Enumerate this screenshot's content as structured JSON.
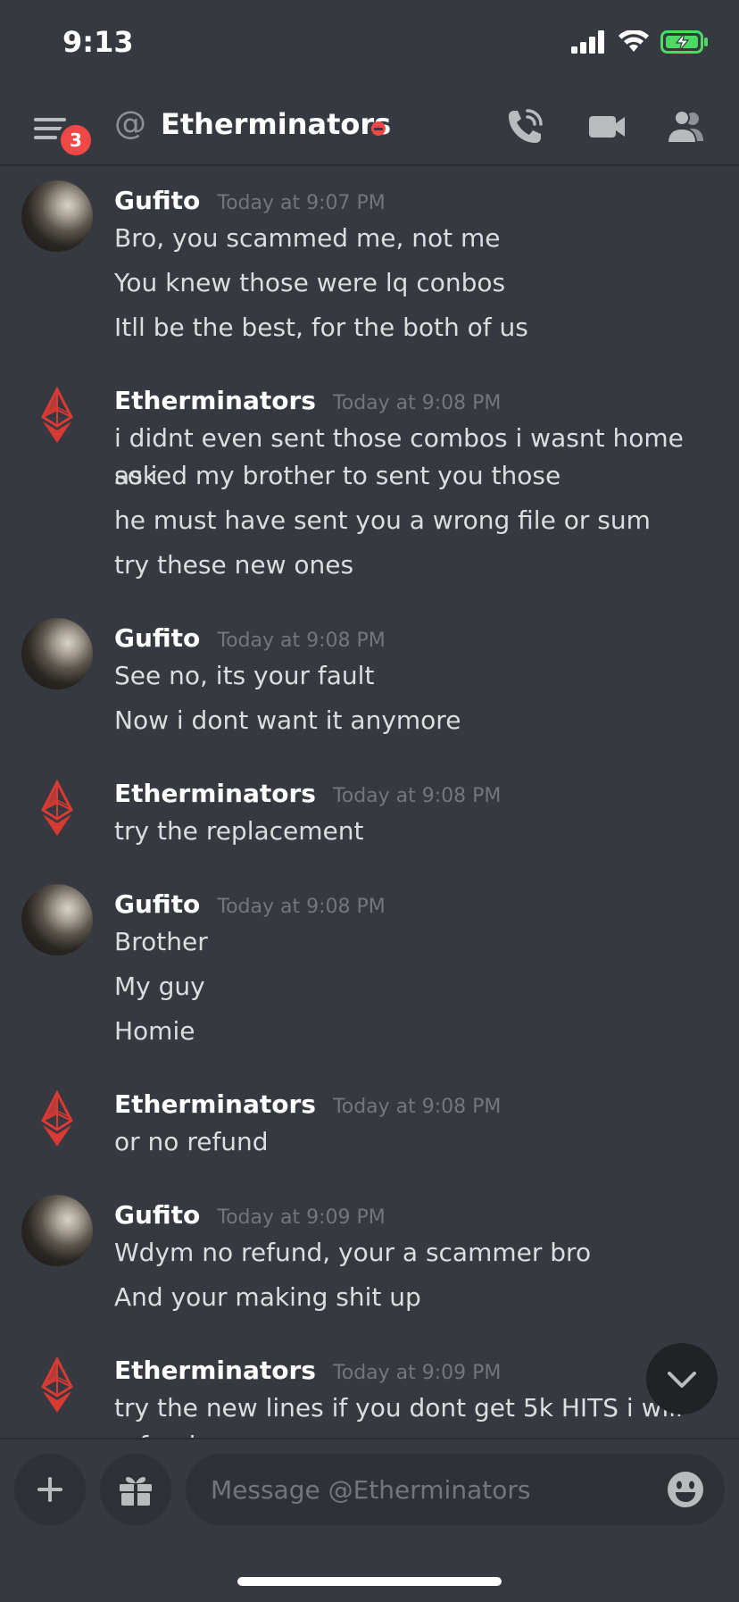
{
  "status_bar": {
    "time": "9:13"
  },
  "header": {
    "unread_badge": "3",
    "at_symbol": "@",
    "title": "Etherminators",
    "status_color": "#f04747"
  },
  "messages": [
    {
      "author": "Gufito",
      "avatar": "photo",
      "timestamp": "Today at 9:07 PM",
      "lines": [
        "Bro, you scammed me, not me",
        "You knew those were lq conbos",
        "Itll be the best, for the both of us"
      ]
    },
    {
      "author": "Etherminators",
      "avatar": "ethereum-logo",
      "timestamp": "Today at 9:08 PM",
      "lines": [
        "i didnt even sent those combos i wasnt home so i",
        "asked my brother to sent you those",
        "he must have sent you a wrong file or sum",
        "try these new ones"
      ]
    },
    {
      "author": "Gufito",
      "avatar": "photo",
      "timestamp": "Today at 9:08 PM",
      "lines": [
        "See no, its your fault",
        "Now i dont want it anymore"
      ]
    },
    {
      "author": "Etherminators",
      "avatar": "ethereum-logo",
      "timestamp": "Today at 9:08 PM",
      "lines": [
        "try the replacement"
      ]
    },
    {
      "author": "Gufito",
      "avatar": "photo",
      "timestamp": "Today at 9:08 PM",
      "lines": [
        "Brother",
        "My guy",
        "Homie"
      ]
    },
    {
      "author": "Etherminators",
      "avatar": "ethereum-logo",
      "timestamp": "Today at 9:08 PM",
      "lines": [
        "or no refund"
      ]
    },
    {
      "author": "Gufito",
      "avatar": "photo",
      "timestamp": "Today at 9:09 PM",
      "lines": [
        "Wdym no refund, your a scammer bro",
        "And your making shit up"
      ]
    },
    {
      "author": "Etherminators",
      "avatar": "ethereum-logo",
      "timestamp": "Today at 9:09 PM",
      "lines": [
        "try the new lines if you dont get 5k HITS i will",
        "refund you"
      ]
    }
  ],
  "composer": {
    "placeholder": "Message @Etherminators"
  },
  "colors": {
    "background": "#36393f",
    "input_background": "#2f3136",
    "accent_red": "#f04747",
    "eth_logo_red": "#d93a34",
    "battery_green": "#4cd964"
  },
  "icons": [
    "menu-icon",
    "at-icon",
    "phone-call-icon",
    "video-camera-icon",
    "members-icon",
    "plus-icon",
    "gift-icon",
    "emoji-icon",
    "chevron-down-icon",
    "signal-icon",
    "wifi-icon",
    "battery-icon"
  ]
}
